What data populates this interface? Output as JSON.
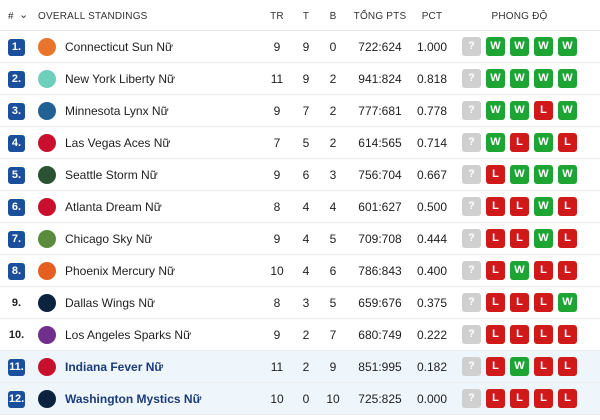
{
  "header": {
    "rank": "#",
    "sort_arrow": "⌄",
    "title": "OVERALL STANDINGS",
    "tr": "TR",
    "t": "T",
    "b": "B",
    "pts": "TỔNG PTS",
    "pct": "PCT",
    "form": "PHONG ĐỘ"
  },
  "rows": [
    {
      "rank": "1.",
      "team": "Connecticut Sun Nữ",
      "tr": "9",
      "t": "9",
      "b": "0",
      "pts": "722:624",
      "pct": "1.000",
      "form": [
        "?",
        "W",
        "W",
        "W",
        "W"
      ],
      "logo_color": "#e8752b"
    },
    {
      "rank": "2.",
      "team": "New York Liberty Nữ",
      "tr": "11",
      "t": "9",
      "b": "2",
      "pts": "941:824",
      "pct": "0.818",
      "form": [
        "?",
        "W",
        "W",
        "W",
        "W"
      ],
      "logo_color": "#6ecfbd"
    },
    {
      "rank": "3.",
      "team": "Minnesota Lynx Nữ",
      "tr": "9",
      "t": "7",
      "b": "2",
      "pts": "777:681",
      "pct": "0.778",
      "form": [
        "?",
        "W",
        "W",
        "L",
        "W"
      ],
      "logo_color": "#236192"
    },
    {
      "rank": "4.",
      "team": "Las Vegas Aces Nữ",
      "tr": "7",
      "t": "5",
      "b": "2",
      "pts": "614:565",
      "pct": "0.714",
      "form": [
        "?",
        "W",
        "L",
        "W",
        "L"
      ],
      "logo_color": "#c8102e"
    },
    {
      "rank": "5.",
      "team": "Seattle Storm Nữ",
      "tr": "9",
      "t": "6",
      "b": "3",
      "pts": "756:704",
      "pct": "0.667",
      "form": [
        "?",
        "L",
        "W",
        "W",
        "W"
      ],
      "logo_color": "#2c5234"
    },
    {
      "rank": "6.",
      "team": "Atlanta Dream Nữ",
      "tr": "8",
      "t": "4",
      "b": "4",
      "pts": "601:627",
      "pct": "0.500",
      "form": [
        "?",
        "L",
        "L",
        "W",
        "L"
      ],
      "logo_color": "#c8102e"
    },
    {
      "rank": "7.",
      "team": "Chicago Sky Nữ",
      "tr": "9",
      "t": "4",
      "b": "5",
      "pts": "709:708",
      "pct": "0.444",
      "form": [
        "?",
        "L",
        "L",
        "W",
        "L"
      ],
      "logo_color": "#5b8c3e"
    },
    {
      "rank": "8.",
      "team": "Phoenix Mercury Nữ",
      "tr": "10",
      "t": "4",
      "b": "6",
      "pts": "786:843",
      "pct": "0.400",
      "form": [
        "?",
        "L",
        "W",
        "L",
        "L"
      ],
      "logo_color": "#e56020"
    },
    {
      "rank": "9.",
      "team": "Dallas Wings Nữ",
      "tr": "8",
      "t": "3",
      "b": "5",
      "pts": "659:676",
      "pct": "0.375",
      "form": [
        "?",
        "L",
        "L",
        "L",
        "W"
      ],
      "logo_color": "#0c2340"
    },
    {
      "rank": "10.",
      "team": "Los Angeles Sparks Nữ",
      "tr": "9",
      "t": "2",
      "b": "7",
      "pts": "680:749",
      "pct": "0.222",
      "form": [
        "?",
        "L",
        "L",
        "L",
        "L"
      ],
      "logo_color": "#702f8a"
    },
    {
      "rank": "11.",
      "team": "Indiana Fever Nữ",
      "tr": "11",
      "t": "2",
      "b": "9",
      "pts": "851:995",
      "pct": "0.182",
      "form": [
        "?",
        "L",
        "W",
        "L",
        "L"
      ],
      "logo_color": "#c8102e"
    },
    {
      "rank": "12.",
      "team": "Washington Mystics Nữ",
      "tr": "10",
      "t": "0",
      "b": "10",
      "pts": "725:825",
      "pct": "0.000",
      "form": [
        "?",
        "L",
        "L",
        "L",
        "L"
      ],
      "logo_color": "#0c2340"
    }
  ]
}
